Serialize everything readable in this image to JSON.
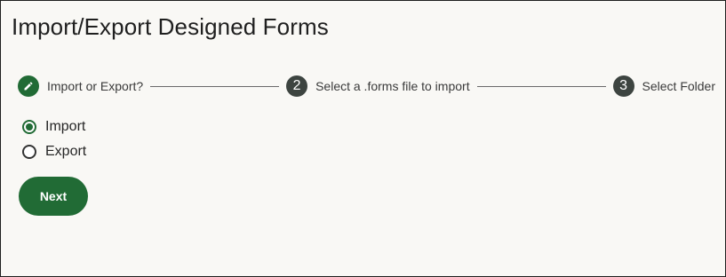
{
  "page": {
    "title": "Import/Export Designed Forms"
  },
  "stepper": {
    "steps": [
      {
        "label": "Import or Export?",
        "icon": "pencil-icon",
        "state": "active"
      },
      {
        "number": "2",
        "label": "Select a .forms file to import",
        "state": "pending"
      },
      {
        "number": "3",
        "label": "Select Folder",
        "state": "pending"
      }
    ]
  },
  "options": {
    "selected": "Import",
    "items": [
      {
        "label": "Import",
        "checked": true
      },
      {
        "label": "Export",
        "checked": false
      }
    ]
  },
  "actions": {
    "next_label": "Next"
  },
  "colors": {
    "accent": "#216b35",
    "step_pending": "#3d4440",
    "background": "#f9f8f5"
  }
}
